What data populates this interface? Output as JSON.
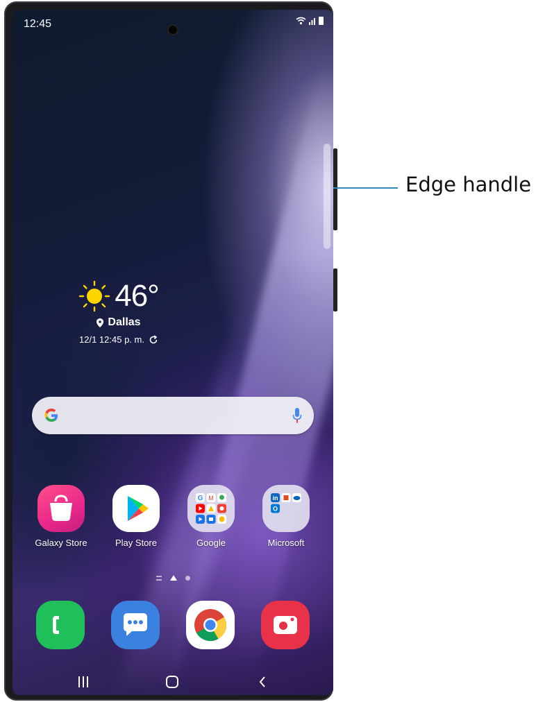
{
  "status_bar": {
    "time": "12:45"
  },
  "weather": {
    "temperature": "46°",
    "location": "Dallas",
    "updated": "12/1 12:45 p. m.",
    "icon": "sun-icon"
  },
  "search": {
    "icon": "google-g-icon",
    "mic_icon": "microphone-icon"
  },
  "apps": [
    {
      "label": "Galaxy Store",
      "icon": "galaxy-store-icon"
    },
    {
      "label": "Play Store",
      "icon": "play-store-icon"
    },
    {
      "label": "Google",
      "icon": "google-folder-icon"
    },
    {
      "label": "Microsoft",
      "icon": "microsoft-folder-icon"
    }
  ],
  "dock": [
    {
      "icon": "phone-icon",
      "color": "#1fbf5a"
    },
    {
      "icon": "messages-icon",
      "color": "#3b82e0"
    },
    {
      "icon": "chrome-icon",
      "color": "#ffffff"
    },
    {
      "icon": "camera-icon",
      "color": "#e8324a"
    }
  ],
  "nav": {
    "recents": "recents-icon",
    "home": "home-icon",
    "back": "back-icon"
  },
  "callout": {
    "label": "Edge handle",
    "color": "#2d8ab5"
  }
}
